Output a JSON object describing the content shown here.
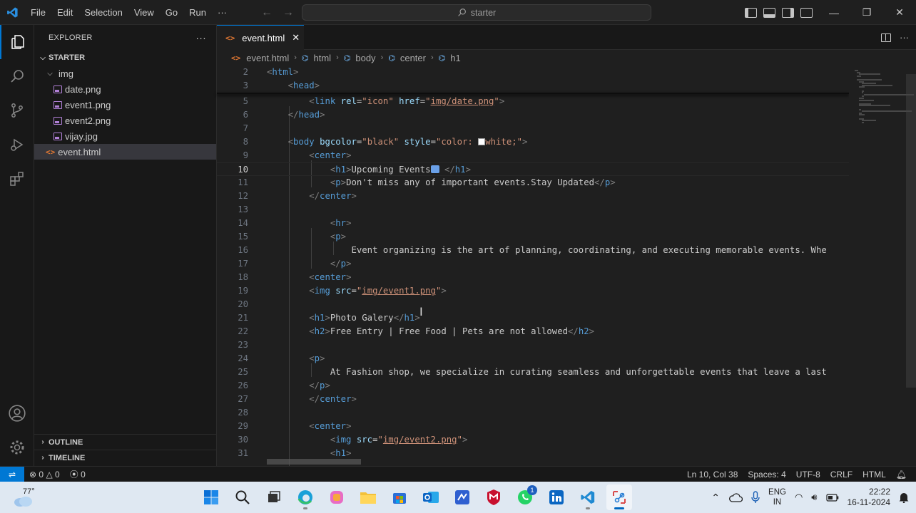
{
  "titlebar": {
    "menu": [
      "File",
      "Edit",
      "Selection",
      "View",
      "Go",
      "Run",
      "···"
    ],
    "search": "starter"
  },
  "explorer": {
    "header": "EXPLORER",
    "more": "···",
    "root": "STARTER",
    "folder": "img",
    "files": [
      "date.png",
      "event1.png",
      "event2.png",
      "vijay.jpg"
    ],
    "active_file": "event.html",
    "outline": "OUTLINE",
    "timeline": "TIMELINE"
  },
  "tab": {
    "label": "event.html",
    "close": "✕"
  },
  "breadcrumb": [
    "event.html",
    "html",
    "body",
    "center",
    "h1"
  ],
  "code": [
    {
      "n": "2",
      "html": "<span class='t-tag'>&lt;</span><span class='t-name'>html</span><span class='t-tag'>&gt;</span>"
    },
    {
      "n": "3",
      "html": "    <span class='t-tag'>&lt;</span><span class='t-name'>head</span><span class='t-tag'>&gt;</span>"
    },
    {
      "n": "5",
      "html": "        <span class='t-tag'>&lt;</span><span class='t-name'>link</span> <span class='t-attr'>rel</span>=<span class='t-str'>\"icon\"</span> <span class='t-attr'>href</span>=<span class='t-str'>\"</span><span class='t-link'>img/date.png</span><span class='t-str'>\"</span><span class='t-tag'>&gt;</span>"
    },
    {
      "n": "6",
      "html": "    <span class='t-tag'>&lt;/</span><span class='t-name'>head</span><span class='t-tag'>&gt;</span>"
    },
    {
      "n": "7",
      "html": ""
    },
    {
      "n": "8",
      "html": "    <span class='t-tag'>&lt;</span><span class='t-name'>body</span> <span class='t-attr'>bgcolor</span>=<span class='t-str'>\"black\"</span> <span class='t-attr'>style</span>=<span class='t-str'>\"color: <span style='display:inline-block;width:10px;height:10px;background:#fff;border:1px solid #999;vertical-align:-1px'></span>white;\"</span><span class='t-tag'>&gt;</span>"
    },
    {
      "n": "9",
      "html": "        <span class='t-tag'>&lt;</span><span class='t-name'>center</span><span class='t-tag'>&gt;</span>"
    },
    {
      "n": "10",
      "html": "            <span class='t-tag'>&lt;</span><span class='t-name'>h1</span><span class='t-tag'>&gt;</span>Upcoming Events<span style='display:inline-block;width:12px;height:11px;background:#6aa0e8;border-radius:2px;vertical-align:-1px'></span> <span class='t-tag'>&lt;/</span><span class='t-name'>h1</span><span class='t-tag'>&gt;</span>",
      "current": true
    },
    {
      "n": "11",
      "html": "            <span class='t-tag'>&lt;</span><span class='t-name'>p</span><span class='t-tag'>&gt;</span>Don't miss any of important events.Stay Updated<span class='t-tag'>&lt;/</span><span class='t-name'>p</span><span class='t-tag'>&gt;</span>"
    },
    {
      "n": "12",
      "html": "        <span class='t-tag'>&lt;/</span><span class='t-name'>center</span><span class='t-tag'>&gt;</span>"
    },
    {
      "n": "13",
      "html": ""
    },
    {
      "n": "14",
      "html": "            <span class='t-tag'>&lt;</span><span class='t-name'>hr</span><span class='t-tag'>&gt;</span>"
    },
    {
      "n": "15",
      "html": "            <span class='t-tag'>&lt;</span><span class='t-name'>p</span><span class='t-tag'>&gt;</span>"
    },
    {
      "n": "16",
      "html": "                Event organizing is the art of planning, coordinating, and executing memorable events. Whe"
    },
    {
      "n": "17",
      "html": "            <span class='t-tag'>&lt;/</span><span class='t-name'>p</span><span class='t-tag'>&gt;</span>"
    },
    {
      "n": "18",
      "html": "        <span class='t-tag'>&lt;</span><span class='t-name'>center</span><span class='t-tag'>&gt;</span>"
    },
    {
      "n": "19",
      "html": "        <span class='t-tag'>&lt;</span><span class='t-name'>img</span> <span class='t-attr'>src</span>=<span class='t-str'>\"</span><span class='t-link'>img/event1.png</span><span class='t-str'>\"</span><span class='t-tag'>&gt;</span>"
    },
    {
      "n": "20",
      "html": ""
    },
    {
      "n": "21",
      "html": "        <span class='t-tag'>&lt;</span><span class='t-name'>h1</span><span class='t-tag'>&gt;</span>Photo Galery<span class='t-tag'>&lt;/</span><span class='t-name'>h1</span><span class='t-tag'>&gt;</span>"
    },
    {
      "n": "22",
      "html": "        <span class='t-tag'>&lt;</span><span class='t-name'>h2</span><span class='t-tag'>&gt;</span>Free Entry | Free Food | Pets are not allowed<span class='t-tag'>&lt;/</span><span class='t-name'>h2</span><span class='t-tag'>&gt;</span>"
    },
    {
      "n": "23",
      "html": ""
    },
    {
      "n": "24",
      "html": "        <span class='t-tag'>&lt;</span><span class='t-name'>p</span><span class='t-tag'>&gt;</span>"
    },
    {
      "n": "25",
      "html": "            At Fashion shop, we specialize in curating seamless and unforgettable events that leave a last"
    },
    {
      "n": "26",
      "html": "        <span class='t-tag'>&lt;/</span><span class='t-name'>p</span><span class='t-tag'>&gt;</span>"
    },
    {
      "n": "27",
      "html": "        <span class='t-tag'>&lt;/</span><span class='t-name'>center</span><span class='t-tag'>&gt;</span>"
    },
    {
      "n": "28",
      "html": ""
    },
    {
      "n": "29",
      "html": "        <span class='t-tag'>&lt;</span><span class='t-name'>center</span><span class='t-tag'>&gt;</span>"
    },
    {
      "n": "30",
      "html": "            <span class='t-tag'>&lt;</span><span class='t-name'>img</span> <span class='t-attr'>src</span>=<span class='t-str'>\"</span><span class='t-link'>img/event2.png</span><span class='t-str'>\"</span><span class='t-tag'>&gt;</span>"
    },
    {
      "n": "31",
      "html": "            <span class='t-tag'>&lt;</span><span class='t-name'>h1</span><span class='t-tag'>&gt;</span>"
    }
  ],
  "status": {
    "errors": "0",
    "warnings": "0",
    "ports": "0",
    "position": "Ln 10, Col 38",
    "spaces": "Spaces: 4",
    "encoding": "UTF-8",
    "eol": "CRLF",
    "language": "HTML"
  },
  "taskbar": {
    "weather": "77°",
    "lang1": "ENG",
    "lang2": "IN",
    "time": "22:22",
    "date": "16-11-2024",
    "whatsapp_badge": "1"
  },
  "colors": {
    "accent": "#0078d4",
    "editor_bg": "#1f1f1f",
    "sidebar_bg": "#181818"
  }
}
